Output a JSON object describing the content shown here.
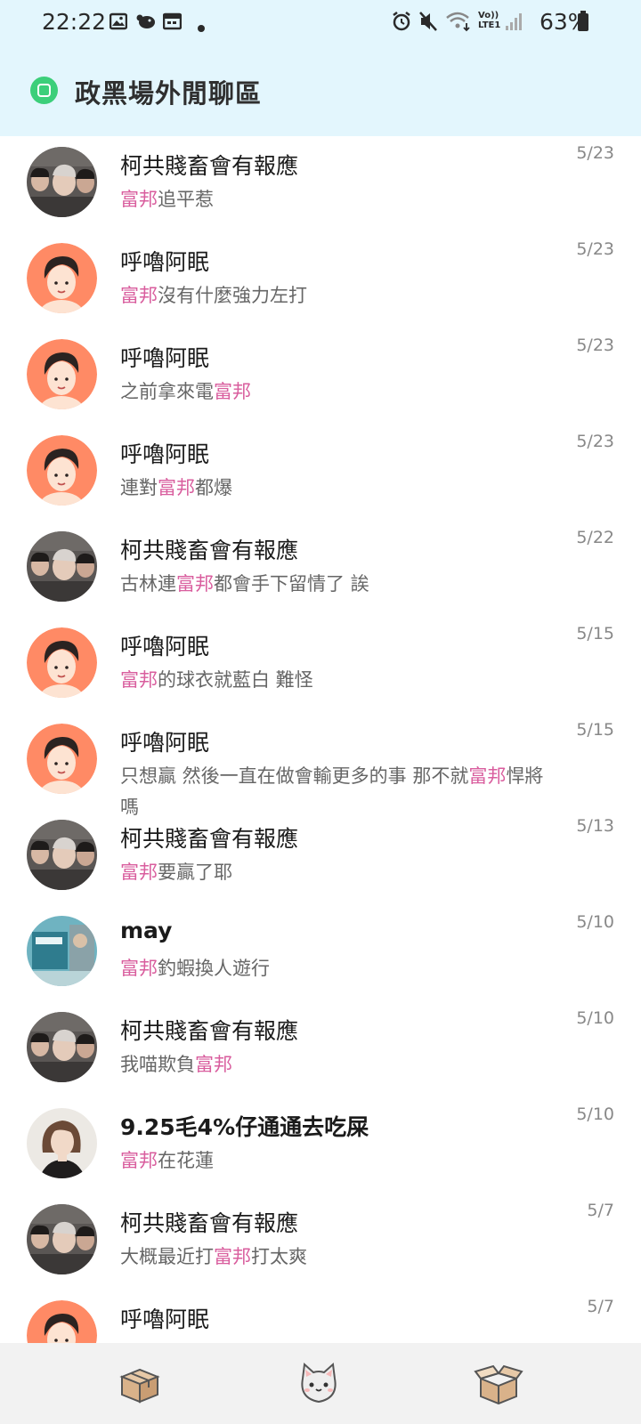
{
  "status_bar": {
    "time": "22:22",
    "battery": "63%",
    "network_label_top": "Vo))",
    "network_label_bottom": "LTE1"
  },
  "header": {
    "title": "政黑場外閒聊區"
  },
  "messages": [
    {
      "name": "柯共賤畜會有報應",
      "avatar": "photo-group",
      "date": "5/23",
      "parts": [
        {
          "text": "富邦",
          "hl": true
        },
        {
          "text": "追平惹",
          "hl": false
        }
      ]
    },
    {
      "name": "呼嚕阿眠",
      "avatar": "cartoon-man",
      "date": "5/23",
      "parts": [
        {
          "text": "富邦",
          "hl": true
        },
        {
          "text": "沒有什麼強力左打",
          "hl": false
        }
      ]
    },
    {
      "name": "呼嚕阿眠",
      "avatar": "cartoon-man",
      "date": "5/23",
      "parts": [
        {
          "text": "之前拿來電",
          "hl": false
        },
        {
          "text": "富邦",
          "hl": true
        }
      ]
    },
    {
      "name": "呼嚕阿眠",
      "avatar": "cartoon-man",
      "date": "5/23",
      "parts": [
        {
          "text": "連對",
          "hl": false
        },
        {
          "text": "富邦",
          "hl": true
        },
        {
          "text": "都爆",
          "hl": false
        }
      ]
    },
    {
      "name": "柯共賤畜會有報應",
      "avatar": "photo-group",
      "date": "5/22",
      "parts": [
        {
          "text": "古林連",
          "hl": false
        },
        {
          "text": "富邦",
          "hl": true
        },
        {
          "text": "都會手下留情了 誒",
          "hl": false
        }
      ]
    },
    {
      "name": "呼嚕阿眠",
      "avatar": "cartoon-man",
      "date": "5/15",
      "parts": [
        {
          "text": "富邦",
          "hl": true
        },
        {
          "text": "的球衣就藍白 難怪",
          "hl": false
        }
      ]
    },
    {
      "name": "呼嚕阿眠",
      "avatar": "cartoon-man",
      "date": "5/15",
      "parts": [
        {
          "text": "只想贏 然後一直在做會輸更多的事 那不就",
          "hl": false
        },
        {
          "text": "富邦",
          "hl": true
        },
        {
          "text": "悍將嗎",
          "hl": false
        }
      ]
    },
    {
      "name": "柯共賤畜會有報應",
      "avatar": "photo-group",
      "date": "5/13",
      "parts": [
        {
          "text": "富邦",
          "hl": true
        },
        {
          "text": "要贏了耶",
          "hl": false
        }
      ]
    },
    {
      "name": "may",
      "avatar": "photo-poster",
      "date": "5/10",
      "bold": true,
      "parts": [
        {
          "text": "富邦",
          "hl": true
        },
        {
          "text": "釣蝦換人遊行",
          "hl": false
        }
      ]
    },
    {
      "name": "柯共賤畜會有報應",
      "avatar": "photo-group",
      "date": "5/10",
      "parts": [
        {
          "text": "我喵欺負",
          "hl": false
        },
        {
          "text": "富邦",
          "hl": true
        }
      ]
    },
    {
      "name": "9.25毛4%仔通通去吃屎",
      "avatar": "photo-woman",
      "date": "5/10",
      "bold_partial": true,
      "parts": [
        {
          "text": "富邦",
          "hl": true
        },
        {
          "text": "在花蓮",
          "hl": false
        }
      ]
    },
    {
      "name": "柯共賤畜會有報應",
      "avatar": "photo-group",
      "date": "5/7",
      "parts": [
        {
          "text": "大概最近打",
          "hl": false
        },
        {
          "text": "富邦",
          "hl": true
        },
        {
          "text": "打太爽",
          "hl": false
        }
      ]
    },
    {
      "name": "呼嚕阿眠",
      "avatar": "cartoon-man",
      "date": "5/7",
      "parts": []
    }
  ],
  "bottom_nav": [
    {
      "icon": "box-closed-icon"
    },
    {
      "icon": "cat-face-icon"
    },
    {
      "icon": "box-open-icon"
    }
  ],
  "colors": {
    "header_bg": "#e3f6fd",
    "highlight": "#d95e9e",
    "logo_green": "#3ccf7a",
    "avatar_orange": "#ff8a65"
  }
}
